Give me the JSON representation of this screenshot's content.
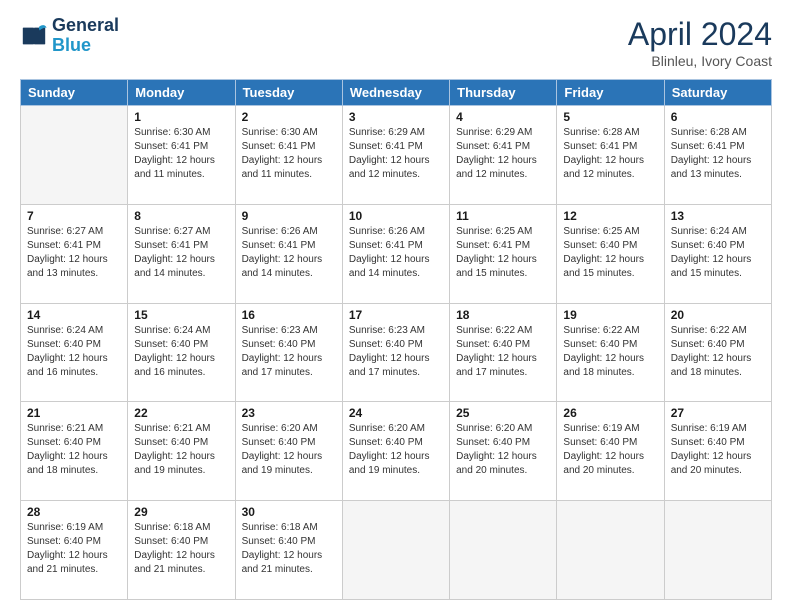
{
  "logo": {
    "line1": "General",
    "line2": "Blue"
  },
  "title": "April 2024",
  "subtitle": "Blinleu, Ivory Coast",
  "days_of_week": [
    "Sunday",
    "Monday",
    "Tuesday",
    "Wednesday",
    "Thursday",
    "Friday",
    "Saturday"
  ],
  "weeks": [
    [
      {
        "day": "",
        "sunrise": "",
        "sunset": "",
        "daylight": "",
        "empty": true
      },
      {
        "day": "1",
        "sunrise": "Sunrise: 6:30 AM",
        "sunset": "Sunset: 6:41 PM",
        "daylight": "Daylight: 12 hours and 11 minutes."
      },
      {
        "day": "2",
        "sunrise": "Sunrise: 6:30 AM",
        "sunset": "Sunset: 6:41 PM",
        "daylight": "Daylight: 12 hours and 11 minutes."
      },
      {
        "day": "3",
        "sunrise": "Sunrise: 6:29 AM",
        "sunset": "Sunset: 6:41 PM",
        "daylight": "Daylight: 12 hours and 12 minutes."
      },
      {
        "day": "4",
        "sunrise": "Sunrise: 6:29 AM",
        "sunset": "Sunset: 6:41 PM",
        "daylight": "Daylight: 12 hours and 12 minutes."
      },
      {
        "day": "5",
        "sunrise": "Sunrise: 6:28 AM",
        "sunset": "Sunset: 6:41 PM",
        "daylight": "Daylight: 12 hours and 12 minutes."
      },
      {
        "day": "6",
        "sunrise": "Sunrise: 6:28 AM",
        "sunset": "Sunset: 6:41 PM",
        "daylight": "Daylight: 12 hours and 13 minutes."
      }
    ],
    [
      {
        "day": "7",
        "sunrise": "Sunrise: 6:27 AM",
        "sunset": "Sunset: 6:41 PM",
        "daylight": "Daylight: 12 hours and 13 minutes."
      },
      {
        "day": "8",
        "sunrise": "Sunrise: 6:27 AM",
        "sunset": "Sunset: 6:41 PM",
        "daylight": "Daylight: 12 hours and 14 minutes."
      },
      {
        "day": "9",
        "sunrise": "Sunrise: 6:26 AM",
        "sunset": "Sunset: 6:41 PM",
        "daylight": "Daylight: 12 hours and 14 minutes."
      },
      {
        "day": "10",
        "sunrise": "Sunrise: 6:26 AM",
        "sunset": "Sunset: 6:41 PM",
        "daylight": "Daylight: 12 hours and 14 minutes."
      },
      {
        "day": "11",
        "sunrise": "Sunrise: 6:25 AM",
        "sunset": "Sunset: 6:41 PM",
        "daylight": "Daylight: 12 hours and 15 minutes."
      },
      {
        "day": "12",
        "sunrise": "Sunrise: 6:25 AM",
        "sunset": "Sunset: 6:40 PM",
        "daylight": "Daylight: 12 hours and 15 minutes."
      },
      {
        "day": "13",
        "sunrise": "Sunrise: 6:24 AM",
        "sunset": "Sunset: 6:40 PM",
        "daylight": "Daylight: 12 hours and 15 minutes."
      }
    ],
    [
      {
        "day": "14",
        "sunrise": "Sunrise: 6:24 AM",
        "sunset": "Sunset: 6:40 PM",
        "daylight": "Daylight: 12 hours and 16 minutes."
      },
      {
        "day": "15",
        "sunrise": "Sunrise: 6:24 AM",
        "sunset": "Sunset: 6:40 PM",
        "daylight": "Daylight: 12 hours and 16 minutes."
      },
      {
        "day": "16",
        "sunrise": "Sunrise: 6:23 AM",
        "sunset": "Sunset: 6:40 PM",
        "daylight": "Daylight: 12 hours and 17 minutes."
      },
      {
        "day": "17",
        "sunrise": "Sunrise: 6:23 AM",
        "sunset": "Sunset: 6:40 PM",
        "daylight": "Daylight: 12 hours and 17 minutes."
      },
      {
        "day": "18",
        "sunrise": "Sunrise: 6:22 AM",
        "sunset": "Sunset: 6:40 PM",
        "daylight": "Daylight: 12 hours and 17 minutes."
      },
      {
        "day": "19",
        "sunrise": "Sunrise: 6:22 AM",
        "sunset": "Sunset: 6:40 PM",
        "daylight": "Daylight: 12 hours and 18 minutes."
      },
      {
        "day": "20",
        "sunrise": "Sunrise: 6:22 AM",
        "sunset": "Sunset: 6:40 PM",
        "daylight": "Daylight: 12 hours and 18 minutes."
      }
    ],
    [
      {
        "day": "21",
        "sunrise": "Sunrise: 6:21 AM",
        "sunset": "Sunset: 6:40 PM",
        "daylight": "Daylight: 12 hours and 18 minutes."
      },
      {
        "day": "22",
        "sunrise": "Sunrise: 6:21 AM",
        "sunset": "Sunset: 6:40 PM",
        "daylight": "Daylight: 12 hours and 19 minutes."
      },
      {
        "day": "23",
        "sunrise": "Sunrise: 6:20 AM",
        "sunset": "Sunset: 6:40 PM",
        "daylight": "Daylight: 12 hours and 19 minutes."
      },
      {
        "day": "24",
        "sunrise": "Sunrise: 6:20 AM",
        "sunset": "Sunset: 6:40 PM",
        "daylight": "Daylight: 12 hours and 19 minutes."
      },
      {
        "day": "25",
        "sunrise": "Sunrise: 6:20 AM",
        "sunset": "Sunset: 6:40 PM",
        "daylight": "Daylight: 12 hours and 20 minutes."
      },
      {
        "day": "26",
        "sunrise": "Sunrise: 6:19 AM",
        "sunset": "Sunset: 6:40 PM",
        "daylight": "Daylight: 12 hours and 20 minutes."
      },
      {
        "day": "27",
        "sunrise": "Sunrise: 6:19 AM",
        "sunset": "Sunset: 6:40 PM",
        "daylight": "Daylight: 12 hours and 20 minutes."
      }
    ],
    [
      {
        "day": "28",
        "sunrise": "Sunrise: 6:19 AM",
        "sunset": "Sunset: 6:40 PM",
        "daylight": "Daylight: 12 hours and 21 minutes."
      },
      {
        "day": "29",
        "sunrise": "Sunrise: 6:18 AM",
        "sunset": "Sunset: 6:40 PM",
        "daylight": "Daylight: 12 hours and 21 minutes."
      },
      {
        "day": "30",
        "sunrise": "Sunrise: 6:18 AM",
        "sunset": "Sunset: 6:40 PM",
        "daylight": "Daylight: 12 hours and 21 minutes."
      },
      {
        "day": "",
        "sunrise": "",
        "sunset": "",
        "daylight": "",
        "empty": true
      },
      {
        "day": "",
        "sunrise": "",
        "sunset": "",
        "daylight": "",
        "empty": true
      },
      {
        "day": "",
        "sunrise": "",
        "sunset": "",
        "daylight": "",
        "empty": true
      },
      {
        "day": "",
        "sunrise": "",
        "sunset": "",
        "daylight": "",
        "empty": true
      }
    ]
  ]
}
